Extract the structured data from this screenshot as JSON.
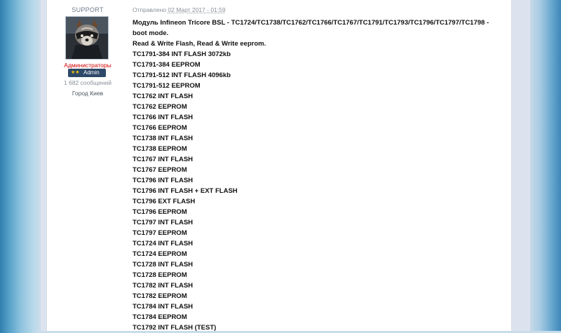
{
  "user": {
    "name": "SUPPORT",
    "group": "Администраторы",
    "rank_stars": "★★",
    "rank_label": "Admin",
    "posts": "1 682 сообщений",
    "location": "Город Киев"
  },
  "post": {
    "posted_label": "Отправлено",
    "date": "02 Март 2017 - 01:59",
    "title": "Модуль Infineon Tricore BSL - TC1724/TC1738/TC1762/TC1766/TC1767/TC1791/TC1793/TC1796/TC1797/TC1798 - boot mode.",
    "lines": [
      "Read & Write Flash, Read & Write eeprom.",
      "TC1791-384 INT FLASH 3072kb",
      "TC1791-384 EEPROM",
      "TC1791-512 INT FLASH 4096kb",
      "TC1791-512 EEPROM",
      "TC1762 INT FLASH",
      "TC1762 EEPROM",
      "TC1766 INT FLASH",
      "TC1766 EEPROM",
      "TC1738 INT FLASH",
      "TC1738 EEPROM",
      "TC1767 INT FLASH",
      "TC1767 EEPROM",
      "TC1796 INT FLASH",
      "TC1796 INT FLASH + EXT FLASH",
      "TC1796 EXT FLASH",
      "TC1796 EEPROM",
      "TC1797 INT FLASH",
      "TC1797 EEPROM",
      "TC1724 INT FLASH",
      "TC1724 EEPROM",
      "TC1728 INT FLASH",
      "TC1728 EEPROM",
      "TC1782 INT FLASH",
      "TC1782 EEPROM",
      "TC1784 INT FLASH",
      "TC1784 EEPROM",
      "TC1792 INT FLASH (TEST)"
    ]
  },
  "colors": {
    "role": "#d10000",
    "rank_bg": "#2d4868",
    "stars": "#f3c500"
  },
  "icons": {
    "avatar": "raccoon-avatar-image"
  }
}
